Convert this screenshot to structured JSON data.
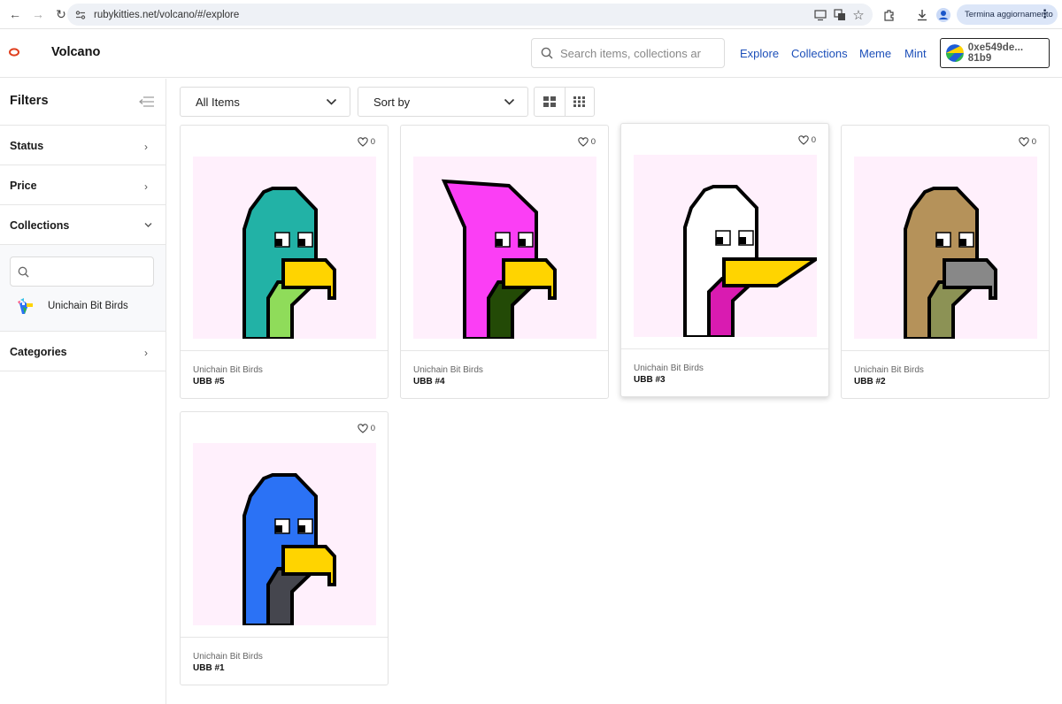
{
  "browser": {
    "url": "rubykitties.net/volcano/#/explore",
    "update_label": "Termina aggiornamento"
  },
  "header": {
    "brand": "Volcano",
    "search_placeholder": "Search items, collections ar",
    "nav": [
      "Explore",
      "Collections",
      "Meme",
      "Mint"
    ],
    "wallet": "0xe549de... 81b9"
  },
  "sidebar": {
    "title": "Filters",
    "status": "Status",
    "price": "Price",
    "collections": "Collections",
    "collection_item": "Unichain Bit Birds",
    "categories": "Categories"
  },
  "toolbar": {
    "filter_select": "All Items",
    "sort_select": "Sort by"
  },
  "colors": {
    "link": "#1c4fb9",
    "card_bg": "#fff0fc",
    "beak": "#ffd400"
  },
  "items": [
    {
      "collection": "Unichain Bit Birds",
      "name": "UBB #5",
      "likes": "0",
      "head": "#22b2a6",
      "body": "#8fdc5a",
      "body2": "#22b2a6",
      "beak": "#ffd400"
    },
    {
      "collection": "Unichain Bit Birds",
      "name": "UBB #4",
      "likes": "0",
      "head": "#fb3ef5",
      "body": "#234a06",
      "body2": "#fb3ef5",
      "beak": "#ffd400"
    },
    {
      "collection": "Unichain Bit Birds",
      "name": "UBB #3",
      "likes": "0",
      "head": "#ffffff",
      "body": "#d91bb1",
      "body2": "#ffffff",
      "beak": "#ffd400"
    },
    {
      "collection": "Unichain Bit Birds",
      "name": "UBB #2",
      "likes": "0",
      "head": "#b5925a",
      "body": "#8c9255",
      "body2": "#b5925a",
      "beak": "#888888"
    },
    {
      "collection": "Unichain Bit Birds",
      "name": "UBB #1",
      "likes": "0",
      "head": "#2b72f5",
      "body": "#45464e",
      "body2": "#2b72f5",
      "beak": "#ffd400"
    }
  ]
}
